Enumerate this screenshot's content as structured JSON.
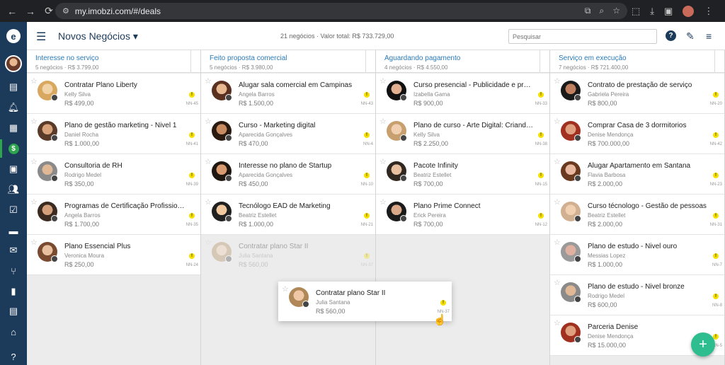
{
  "browser": {
    "url": "my.imobzi.com/#/deals",
    "back_icon": "arrow-left-icon",
    "forward_icon": "arrow-right-icon",
    "reload_icon": "reload-icon"
  },
  "header": {
    "title": "Novos Negócios",
    "summary": "21 negócios · Valor total: R$ 733.729,00",
    "search_placeholder": "Pesquisar",
    "help_label": "?"
  },
  "columns": [
    {
      "title": "Interesse no serviço",
      "subtitle": "5 negócios · R$ 3.799,00",
      "cards": [
        {
          "title": "Contratar Plano Liberty",
          "person": "Kelly Silva",
          "value": "R$ 499,00",
          "code": "NN-45"
        },
        {
          "title": "Plano de gestão marketing - Nivel 1",
          "person": "Daniel Rocha",
          "value": "R$ 1.000,00",
          "code": "NN-41"
        },
        {
          "title": "Consultoria de RH",
          "person": "Rodrigo Medel",
          "value": "R$ 350,00",
          "code": "NN-39"
        },
        {
          "title": "Programas de Certificação Profission...",
          "person": "Angela Barros",
          "value": "R$ 1.700,00",
          "code": "NN-35"
        },
        {
          "title": "Plano Essencial Plus",
          "person": "Veronica Moura",
          "value": "R$ 250,00",
          "code": "NN-24"
        }
      ]
    },
    {
      "title": "Feito proposta comercial",
      "subtitle": "5 negócios · R$ 3.980,00",
      "cards": [
        {
          "title": "Alugar sala comercial em Campinas",
          "person": "Angela Barros",
          "value": "R$ 1.500,00",
          "code": "NN-43"
        },
        {
          "title": "Curso - Marketing digital",
          "person": "Aparecida Gonçalves",
          "value": "R$ 470,00",
          "code": "NN-4"
        },
        {
          "title": "Interesse no plano de Startup",
          "person": "Aparecida Gonçalves",
          "value": "R$ 450,00",
          "code": "NN-10"
        },
        {
          "title": "Tecnólogo EAD de Marketing",
          "person": "Beatriz Estellet",
          "value": "R$ 1.000,00",
          "code": "NN-21"
        },
        {
          "title": "Contratar plano Star II",
          "person": "Julia Santana",
          "value": "R$ 560,00",
          "code": "NN-37"
        }
      ]
    },
    {
      "title": "Aguardando pagamento",
      "subtitle": "4 negócios · R$ 4.550,00",
      "cards": [
        {
          "title": "Curso presencial - Publicidade e prop...",
          "person": "Izabella Gama",
          "value": "R$ 900,00",
          "code": "NN-33"
        },
        {
          "title": "Plano de curso - Arte Digital: Criando I...",
          "person": "Kelly Silva",
          "value": "R$ 2.250,00",
          "code": "NN-38"
        },
        {
          "title": "Pacote Infinity",
          "person": "Beatriz Estellet",
          "value": "R$ 700,00",
          "code": "NN-15"
        },
        {
          "title": "Plano Prime Connect",
          "person": "Erick Pereira",
          "value": "R$ 700,00",
          "code": "NN-12"
        }
      ]
    },
    {
      "title": "Serviço em execução",
      "subtitle": "7 negócios · R$ 721.400,00",
      "cards": [
        {
          "title": "Contrato de prestação de serviço",
          "person": "Gabriela Pereira",
          "value": "R$ 800,00",
          "code": "NN-20"
        },
        {
          "title": "Comprar Casa de 3 dormitorios",
          "person": "Denise Mendonça",
          "value": "R$ 700.000,00",
          "code": "NN-42"
        },
        {
          "title": "Alugar Apartamento em Santana",
          "person": "Flavia Barbosa",
          "value": "R$ 2.000,00",
          "code": "NN-23"
        },
        {
          "title": "Curso técnologo - Gestão de pessoas",
          "person": "Beatriz Estellet",
          "value": "R$ 2.000,00",
          "code": "NN-31"
        },
        {
          "title": "Plano de estudo - Nivel ouro",
          "person": "Messias Lopez",
          "value": "R$ 1.000,00",
          "code": "NN-7"
        },
        {
          "title": "Plano de estudo - Nivel bronze",
          "person": "Rodrigo Medel",
          "value": "R$ 600,00",
          "code": "NN-8"
        },
        {
          "title": "Parceria Denise",
          "person": "Denise Mendonça",
          "value": "R$ 15.000,00",
          "code": "NN-5"
        }
      ]
    }
  ],
  "drag_card": {
    "title": "Contratar plano Star II",
    "person": "Julia Santana",
    "value": "R$ 560,00",
    "code": "NN-37"
  },
  "fab_label": "+",
  "warn_label": "!",
  "colors": {
    "sidebar": "#1c3a5a",
    "accent": "#2a7ab8",
    "success": "#2ebd8f",
    "warning": "#f5e000"
  }
}
